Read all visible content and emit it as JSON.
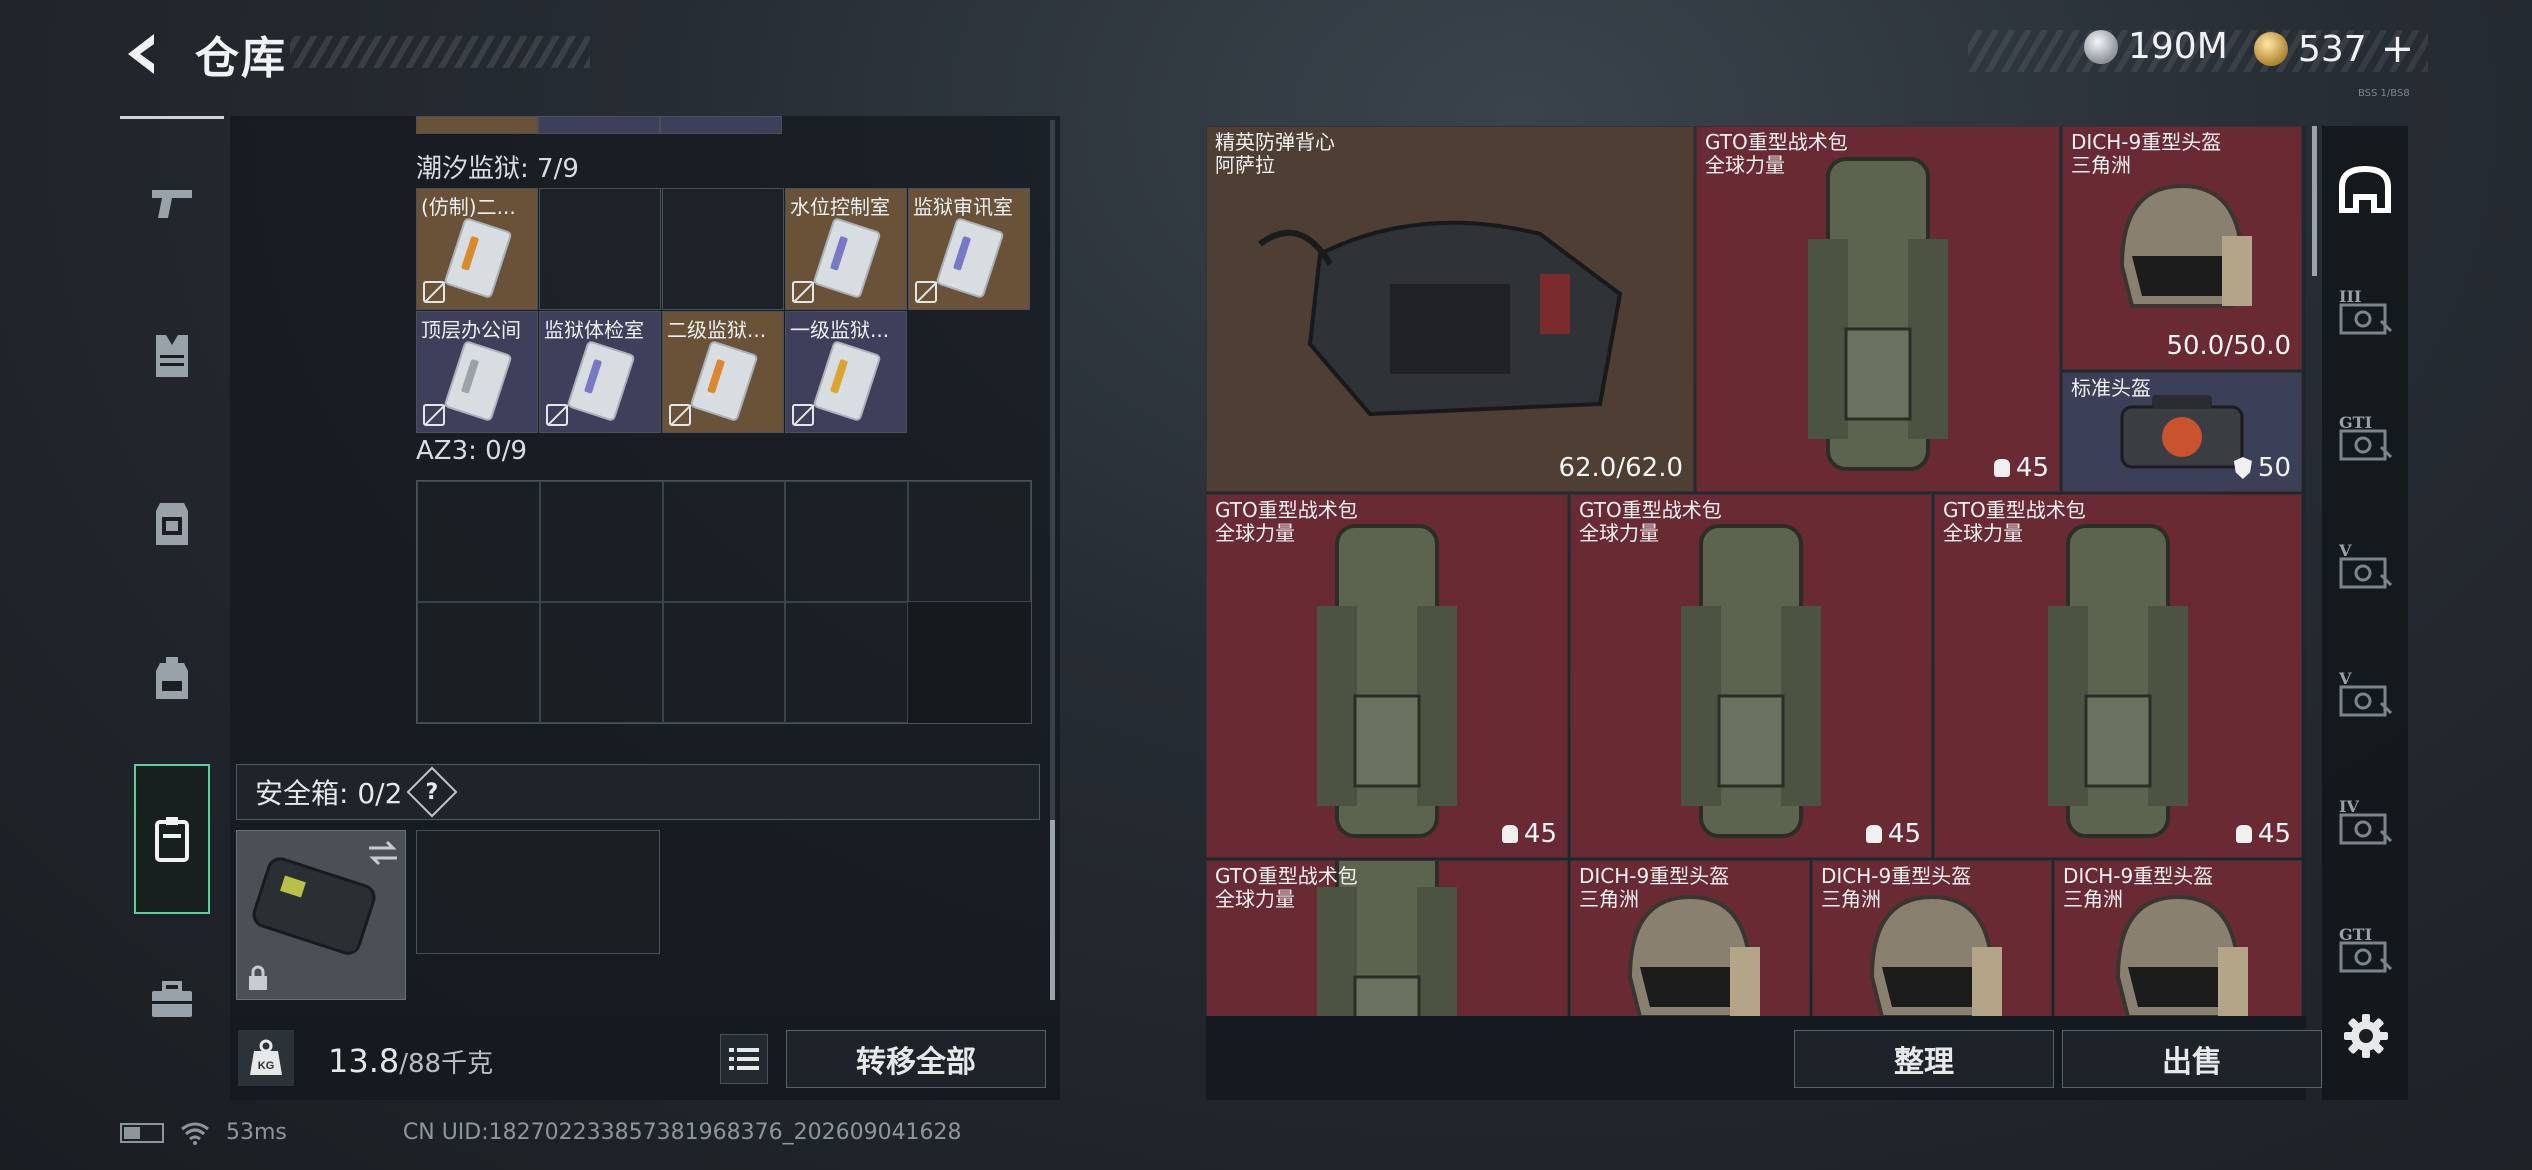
{
  "header": {
    "title": "仓库",
    "currency_silver": "190M",
    "currency_gold": "537",
    "add_label": "+",
    "version_tag": "BSS 1/BS8"
  },
  "left_nav": {
    "items": [
      {
        "icon": "pistol-icon"
      },
      {
        "icon": "vest-icon"
      },
      {
        "icon": "chest-rig-icon"
      },
      {
        "icon": "backpack-icon"
      },
      {
        "icon": "safe-box-icon",
        "active": true
      },
      {
        "icon": "briefcase-icon"
      }
    ]
  },
  "storage": {
    "tidal_prison_label": "潮汐监狱: 7/9",
    "tidal_prison_slots": [
      {
        "label": "(仿制)二...",
        "color": "brown",
        "stripe": "#d98a2e"
      },
      {
        "label": "",
        "color": "empty"
      },
      {
        "label": "",
        "color": "empty"
      },
      {
        "label": "水位控制室",
        "color": "brown",
        "stripe": "#7a78c4"
      },
      {
        "label": "监狱审讯室",
        "color": "brown",
        "stripe": "#7a78c4"
      },
      {
        "label": "顶层办公间",
        "color": "purple",
        "stripe": "#9aa1a8"
      },
      {
        "label": "监狱体检室",
        "color": "purple",
        "stripe": "#7a78c4"
      },
      {
        "label": "二级监狱...",
        "color": "brown",
        "stripe": "#d98a2e"
      },
      {
        "label": "一级监狱...",
        "color": "purple",
        "stripe": "#d9a52e"
      }
    ],
    "az3_label": "AZ3: 0/9",
    "safe_box_label": "安全箱: 0/2",
    "help_label": "?",
    "weight_current": "13.8",
    "weight_max": "/88千克",
    "weight_icon_label": "KG",
    "transfer_all_label": "转移全部"
  },
  "status": {
    "ping": "53ms",
    "uid": "CN UID:1827022338573819​68376_202609041628"
  },
  "loot": {
    "items": [
      {
        "name": "精英防弹背心",
        "sub": "阿萨拉",
        "value": "62.0/62.0",
        "badge": "",
        "color": "brown"
      },
      {
        "name": "GTO重型战术包",
        "sub": "全球力量",
        "value": "45",
        "badge": "bag",
        "color": "red"
      },
      {
        "name": "DICH-9重型头盔",
        "sub": "三角洲",
        "value": "50.0/50.0",
        "badge": "",
        "color": "red"
      },
      {
        "name": "标准头盔",
        "sub": "",
        "value": "50",
        "badge": "shield",
        "color": "purple"
      },
      {
        "name": "GTO重型战术包",
        "sub": "全球力量",
        "value": "45",
        "badge": "bag",
        "color": "red"
      },
      {
        "name": "GTO重型战术包",
        "sub": "全球力量",
        "value": "45",
        "badge": "bag",
        "color": "red"
      },
      {
        "name": "GTO重型战术包",
        "sub": "全球力量",
        "value": "45",
        "badge": "bag",
        "color": "red"
      },
      {
        "name": "GTO重型战术包",
        "sub": "全球力量",
        "value": "",
        "badge": "",
        "color": "red"
      },
      {
        "name": "DICH-9重型头盔",
        "sub": "三角洲",
        "value": "",
        "badge": "",
        "color": "red"
      },
      {
        "name": "DICH-9重型头盔",
        "sub": "三角洲",
        "value": "",
        "badge": "",
        "color": "red"
      },
      {
        "name": "DICH-9重型头盔",
        "sub": "三角洲",
        "value": "",
        "badge": "",
        "color": "red"
      }
    ],
    "tidy_label": "整理",
    "sell_label": "出售"
  },
  "right_rail": {
    "items": [
      {
        "icon": "helmet-filter-icon",
        "tier": ""
      },
      {
        "icon": "rig-tier-3-icon",
        "tier": "III"
      },
      {
        "icon": "gti-case-icon",
        "tier": "GTI"
      },
      {
        "icon": "vault-v-icon",
        "tier": "V"
      },
      {
        "icon": "vault-v2-icon",
        "tier": "V"
      },
      {
        "icon": "tier-4-box-icon",
        "tier": "IV"
      },
      {
        "icon": "gti-box-icon",
        "tier": "GTI"
      }
    ]
  },
  "colors": {
    "accent_green": "#5fcf95",
    "rarity_red": "#6a2a33",
    "rarity_brown": "#4e3e33",
    "rarity_purple": "#3c3f58"
  }
}
